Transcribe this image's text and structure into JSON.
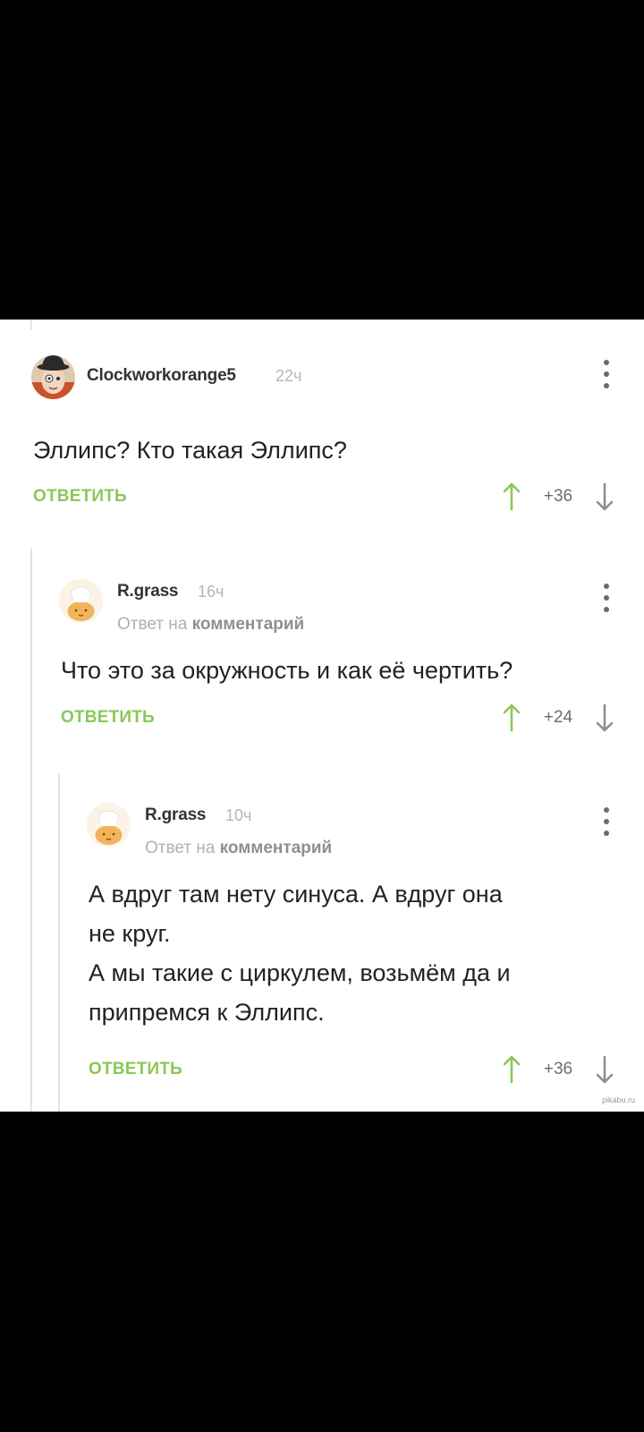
{
  "comments": [
    {
      "author": "Clockworkorange5",
      "time": "22ч",
      "text": "Эллипс? Кто такая Эллипс?",
      "reply_label": "ОТВЕТИТЬ",
      "score": "+36",
      "avatar": "bowler-hat-face-avatar"
    },
    {
      "author": "R.grass",
      "time": "16ч",
      "reply_prefix": "Ответ на",
      "reply_link": "комментарий",
      "text": "Что это за окружность и как её чертить?",
      "reply_label": "ОТВЕТИТЬ",
      "score": "+24",
      "avatar": "chef-bun-avatar"
    },
    {
      "author": "R.grass",
      "time": "10ч",
      "reply_prefix": "Ответ на",
      "reply_link": "комментарий",
      "text_lines": [
        "А вдруг там нету синуса. А вдруг она",
        "не круг.",
        "А мы такие с циркулем, возьмём да и",
        "припремся к Эллипс."
      ],
      "reply_label": "ОТВЕТИТЬ",
      "score": "+36",
      "avatar": "chef-bun-avatar"
    }
  ],
  "watermark": "pikabu.ru",
  "colors": {
    "accent_green": "#8ac858",
    "background": "#ffffff",
    "frame": "#000000"
  }
}
